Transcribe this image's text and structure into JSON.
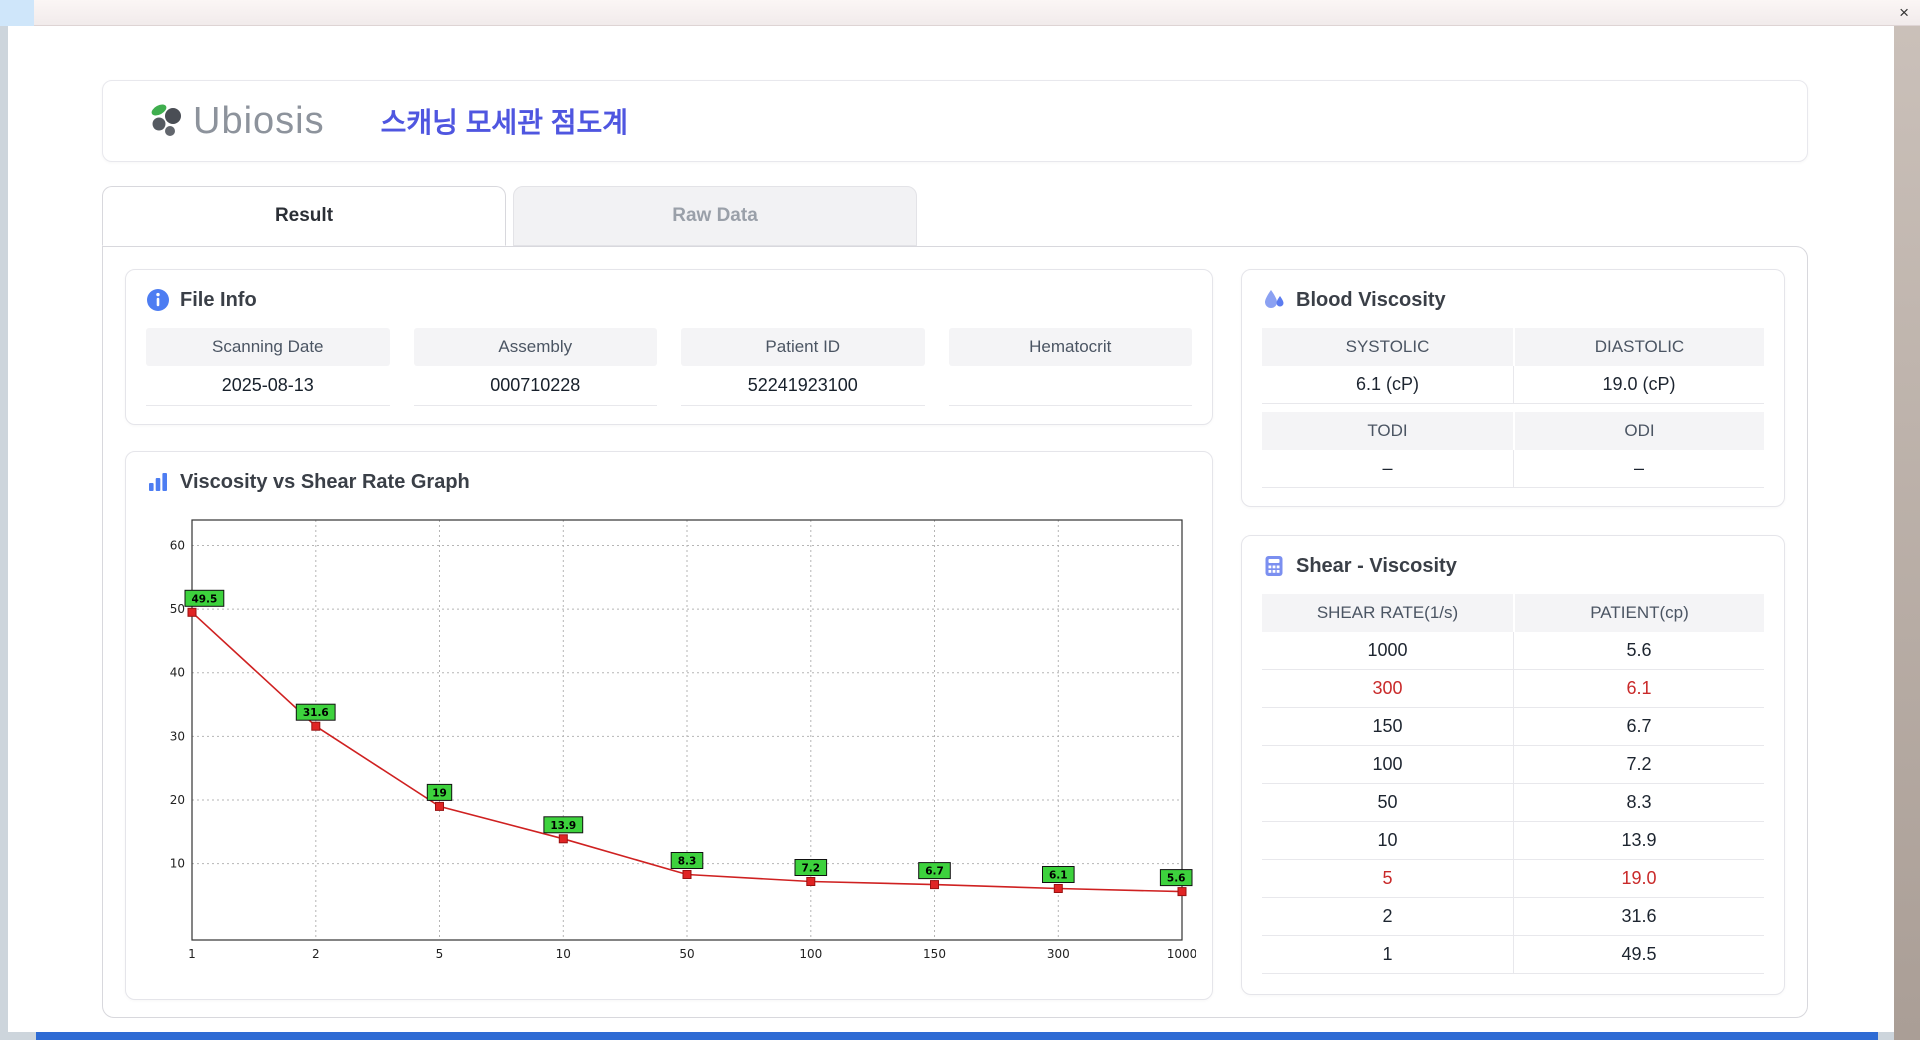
{
  "window": {
    "close_label": "×"
  },
  "header": {
    "brand": "Ubiosis",
    "app_title": "스캐닝 모세관 점도계"
  },
  "tabs": [
    {
      "label": "Result",
      "active": true
    },
    {
      "label": "Raw Data",
      "active": false
    }
  ],
  "file_info": {
    "title": "File Info",
    "fields": [
      {
        "label": "Scanning Date",
        "value": "2025-08-13"
      },
      {
        "label": "Assembly",
        "value": "000710228"
      },
      {
        "label": "Patient ID",
        "value": "52241923100"
      },
      {
        "label": "Hematocrit",
        "value": ""
      }
    ]
  },
  "graph": {
    "title": "Viscosity vs Shear Rate Graph"
  },
  "blood_viscosity": {
    "title": "Blood Viscosity",
    "row1": {
      "headers": [
        "SYSTOLIC",
        "DIASTOLIC"
      ],
      "values": [
        "6.1 (cP)",
        "19.0 (cP)"
      ]
    },
    "row2": {
      "headers": [
        "TODI",
        "ODI"
      ],
      "values": [
        "–",
        "–"
      ]
    }
  },
  "shear_viscosity": {
    "title": "Shear - Viscosity",
    "columns": [
      "SHEAR RATE(1/s)",
      "PATIENT(cp)"
    ],
    "rows": [
      {
        "shear": "1000",
        "patient": "5.6",
        "highlight": false
      },
      {
        "shear": "300",
        "patient": "6.1",
        "highlight": true
      },
      {
        "shear": "150",
        "patient": "6.7",
        "highlight": false
      },
      {
        "shear": "100",
        "patient": "7.2",
        "highlight": false
      },
      {
        "shear": "50",
        "patient": "8.3",
        "highlight": false
      },
      {
        "shear": "10",
        "patient": "13.9",
        "highlight": false
      },
      {
        "shear": "5",
        "patient": "19.0",
        "highlight": true
      },
      {
        "shear": "2",
        "patient": "31.6",
        "highlight": false
      },
      {
        "shear": "1",
        "patient": "49.5",
        "highlight": false
      }
    ]
  },
  "chart_data": {
    "type": "line",
    "title": "",
    "xlabel": "",
    "ylabel": "",
    "categories": [
      "1",
      "2",
      "5",
      "10",
      "50",
      "100",
      "150",
      "300",
      "1000"
    ],
    "values": [
      49.5,
      31.6,
      19,
      13.9,
      8.3,
      7.2,
      6.7,
      6.1,
      5.6
    ],
    "labels": [
      "49.5",
      "31.6",
      "19",
      "13.9",
      "8.3",
      "7.2",
      "6.7",
      "6.1",
      "5.6"
    ],
    "yticks": [
      10,
      20,
      30,
      40,
      50,
      60
    ],
    "ylim": [
      -2,
      64
    ],
    "x_scale": "categorical-log-ticks",
    "grid": true,
    "legend": "none",
    "line_color": "#cf2121",
    "marker_color": "#e02424",
    "marker_edge": "#991111",
    "label_bg": "#3dd23d",
    "label_border": "#111111"
  },
  "colors": {
    "accent_blue": "#4f56e0",
    "icon_blue": "#4d7df2",
    "table_red": "#c92a2a",
    "chart_green": "#3dd23d",
    "chart_red": "#cf2121",
    "taskbar_blue": "#2e6bd4"
  }
}
